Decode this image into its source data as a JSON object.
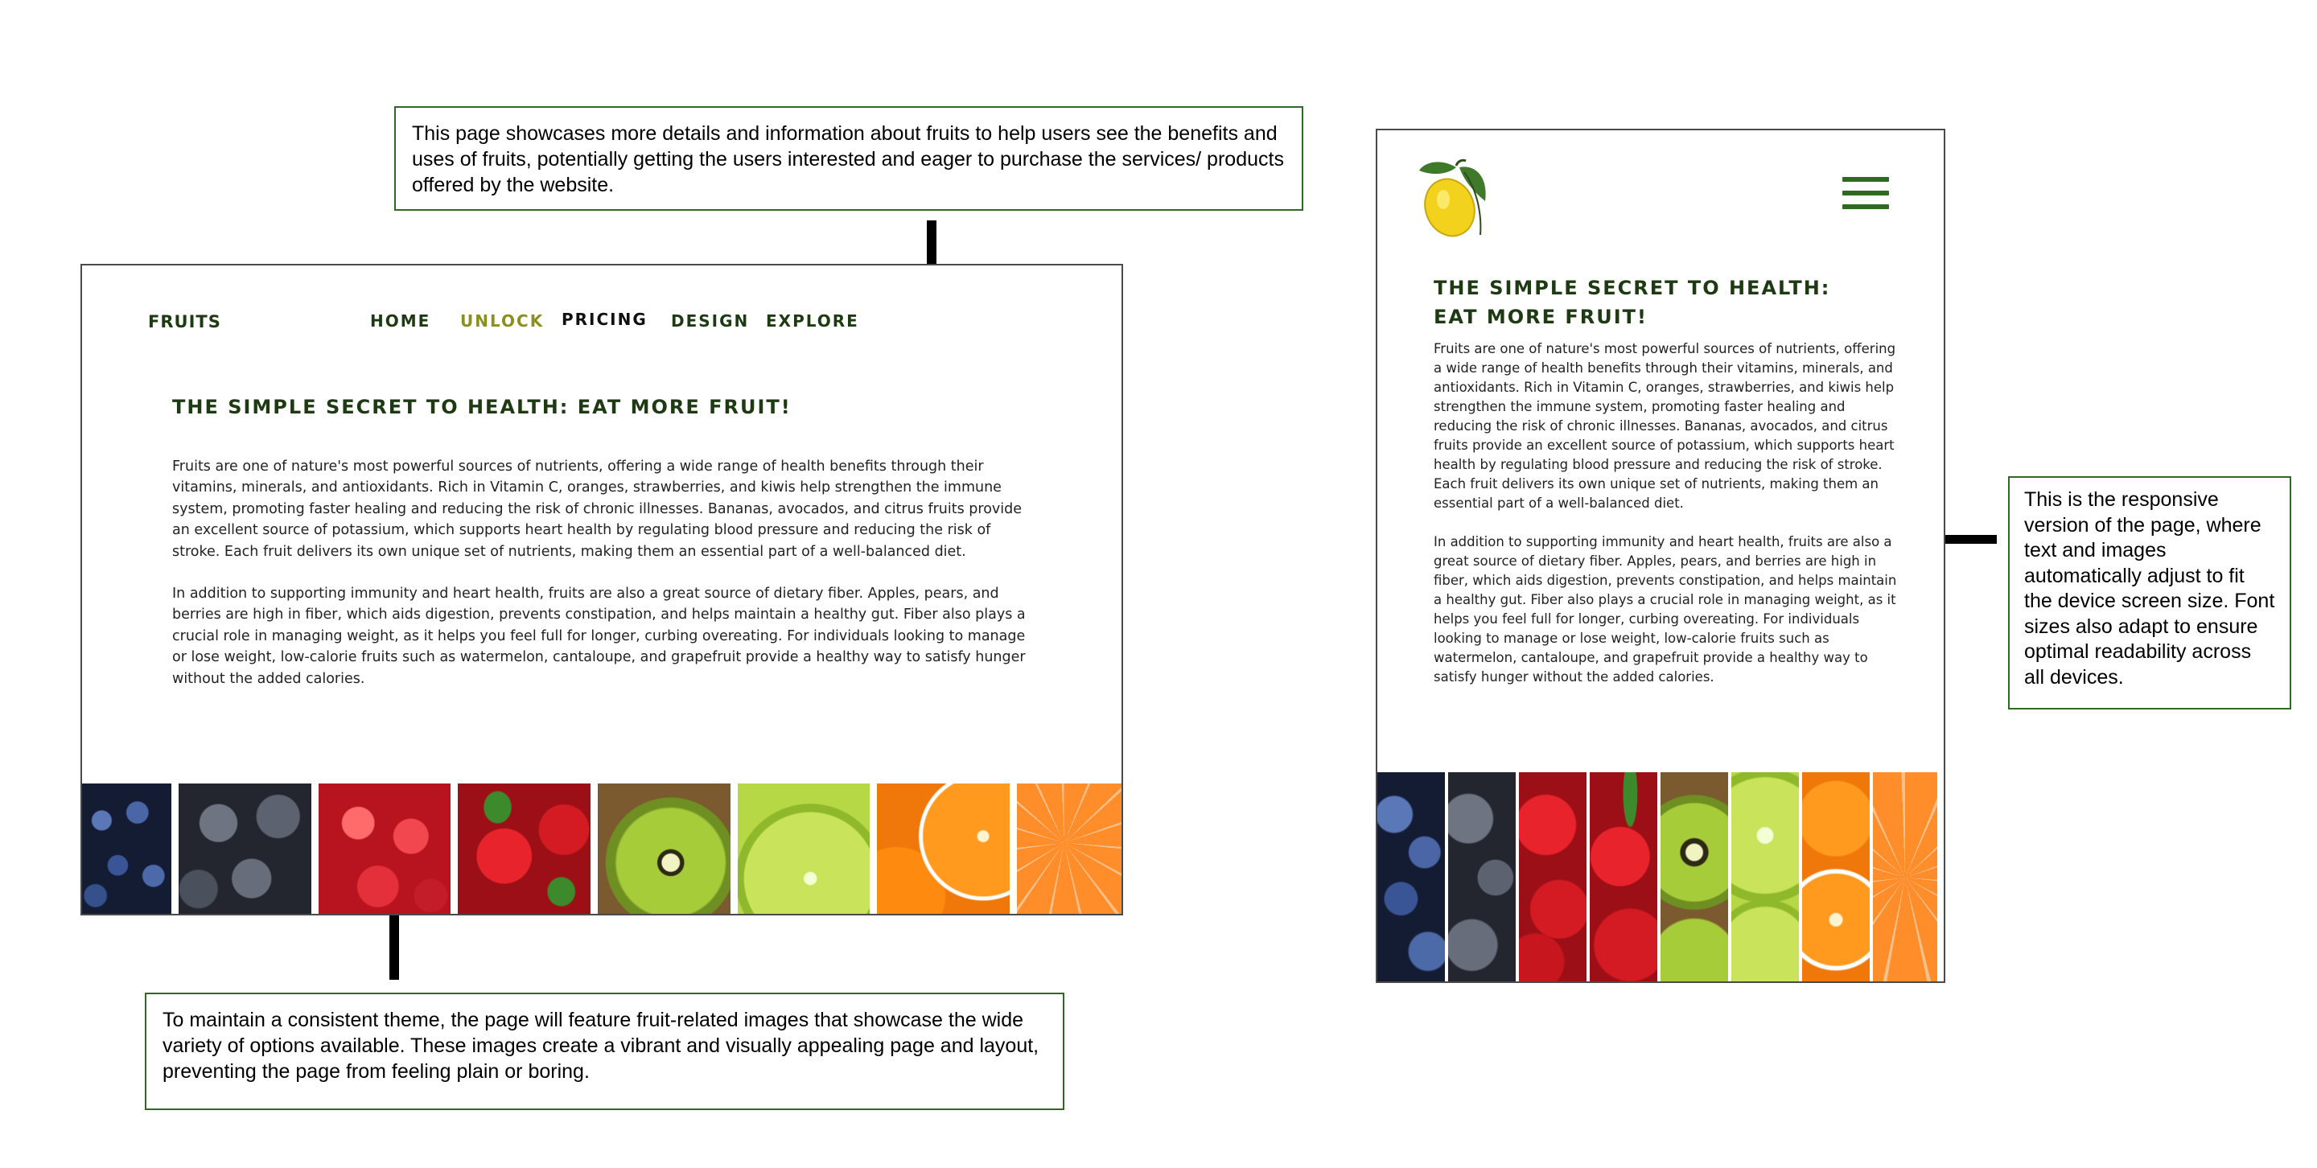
{
  "annotations": {
    "top": "This page showcases more details and information about fruits to help users see the benefits and uses of fruits, potentially getting the users interested and eager to purchase the services/ products offered by the website.",
    "bottom": "To maintain a consistent theme, the page will feature fruit-related images that showcase the wide variety of options available. These images create a vibrant and visually appealing page and layout, preventing the page from feeling plain or boring.",
    "right": "This is the responsive version of the page, where text and images automatically adjust to fit the device screen size. Font sizes also adapt to ensure optimal readability across all devices."
  },
  "desktop": {
    "brand": "FRUITS",
    "nav": [
      {
        "label": "HOME",
        "state": "default"
      },
      {
        "label": "UNLOCK",
        "state": "active"
      },
      {
        "label": "PRICING",
        "state": "dark"
      },
      {
        "label": "DESIGN",
        "state": "default"
      },
      {
        "label": "EXPLORE",
        "state": "default"
      }
    ],
    "headline": "THE SIMPLE SECRET TO HEALTH: EAT MORE FRUIT!",
    "paragraph1": "Fruits are one of nature's most powerful sources of nutrients, offering a wide range of health benefits through their vitamins, minerals, and antioxidants. Rich in Vitamin C, oranges, strawberries, and kiwis help strengthen the immune system, promoting faster healing and reducing the risk of chronic illnesses. Bananas, avocados, and citrus fruits provide an excellent source of potassium, which supports heart health by regulating blood pressure and reducing the risk of stroke. Each fruit delivers its own unique set of nutrients, making them an essential part of a well-balanced diet.",
    "paragraph2": "In addition to supporting immunity and heart health, fruits are also a great source of dietary fiber. Apples, pears, and berries are high in fiber, which aids digestion, prevents constipation, and helps maintain a healthy gut. Fiber also plays a crucial role in managing weight, as it helps you feel full for longer, curbing overeating. For individuals looking to manage or lose weight, low-calorie fruits such as watermelon, cantaloupe, and grapefruit provide a healthy way to satisfy hunger without the added calories."
  },
  "mobile": {
    "headline_line1": "THE SIMPLE SECRET TO HEALTH:",
    "headline_line2": "EAT MORE FRUIT!",
    "logo_icon": "lemon-icon",
    "menu_icon": "hamburger-icon"
  },
  "fruit_images": [
    "blueberries",
    "grapes",
    "raspberries",
    "strawberries",
    "kiwi",
    "lime",
    "orange",
    "tangerine"
  ],
  "colors": {
    "brand_green": "#1d3a12",
    "accent_olive": "#8a8f1e",
    "annotation_border": "#2e6a22"
  }
}
